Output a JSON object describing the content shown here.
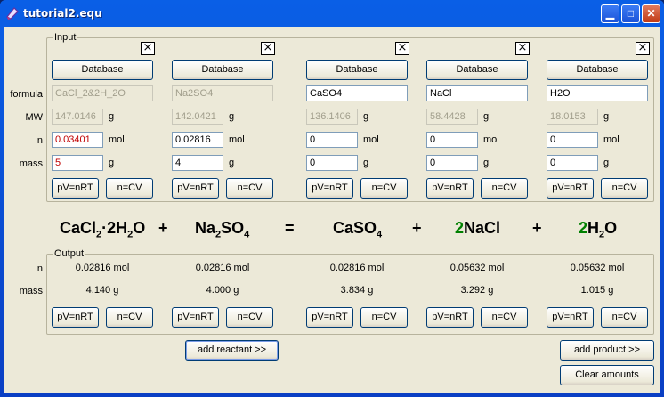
{
  "window": {
    "title": "tutorial2.equ"
  },
  "input_group": {
    "label": "Input"
  },
  "output_group": {
    "label": "Output"
  },
  "row_labels": {
    "formula": "formula",
    "mw": "MW",
    "n": "n",
    "mass": "mass"
  },
  "output_row_labels": {
    "n": "n",
    "mass": "mass"
  },
  "units": {
    "g": "g",
    "mol": "mol"
  },
  "buttons": {
    "database": "Database",
    "pv": "pV=nRT",
    "ncv": "n=CV",
    "close": "×",
    "add_reactant": "add reactant >>",
    "add_product": "add product >>",
    "clear": "Clear amounts"
  },
  "columns": [
    {
      "formula": "CaCl_2&2H_2O",
      "mw": "147.0146",
      "n": "0.03401",
      "mass": "5",
      "out_n": "0.02816 mol",
      "out_mass": "4.140 g"
    },
    {
      "formula": "Na2SO4",
      "mw": "142.0421",
      "n": "0.02816",
      "mass": "4",
      "out_n": "0.02816 mol",
      "out_mass": "4.000 g"
    },
    {
      "formula": "CaSO4",
      "mw": "136.1406",
      "n": "0",
      "mass": "0",
      "out_n": "0.02816 mol",
      "out_mass": "3.834 g"
    },
    {
      "formula": "NaCl",
      "mw": "58.4428",
      "n": "0",
      "mass": "0",
      "out_n": "0.05632 mol",
      "out_mass": "3.292 g"
    },
    {
      "formula": "H2O",
      "mw": "18.0153",
      "n": "0",
      "mass": "0",
      "out_n": "0.05632 mol",
      "out_mass": "1.015 g"
    }
  ],
  "equation": {
    "t1a": "CaCl",
    "t1b": "2",
    "t1c": "·2H",
    "t1d": "2",
    "t1e": "O",
    "plus": "+",
    "equals": "=",
    "t2a": "Na",
    "t2b": "2",
    "t2c": "SO",
    "t2d": "4",
    "t3a": "CaSO",
    "t3b": "4",
    "t4coef": "2",
    "t4": "NaCl",
    "t5coef": "2",
    "t5a": "H",
    "t5b": "2",
    "t5c": "O"
  },
  "colors": {
    "titlebar": "#0a4fd6",
    "window_bg": "#ece9d8",
    "coefficient": "#008000",
    "error_text": "#c00000"
  }
}
